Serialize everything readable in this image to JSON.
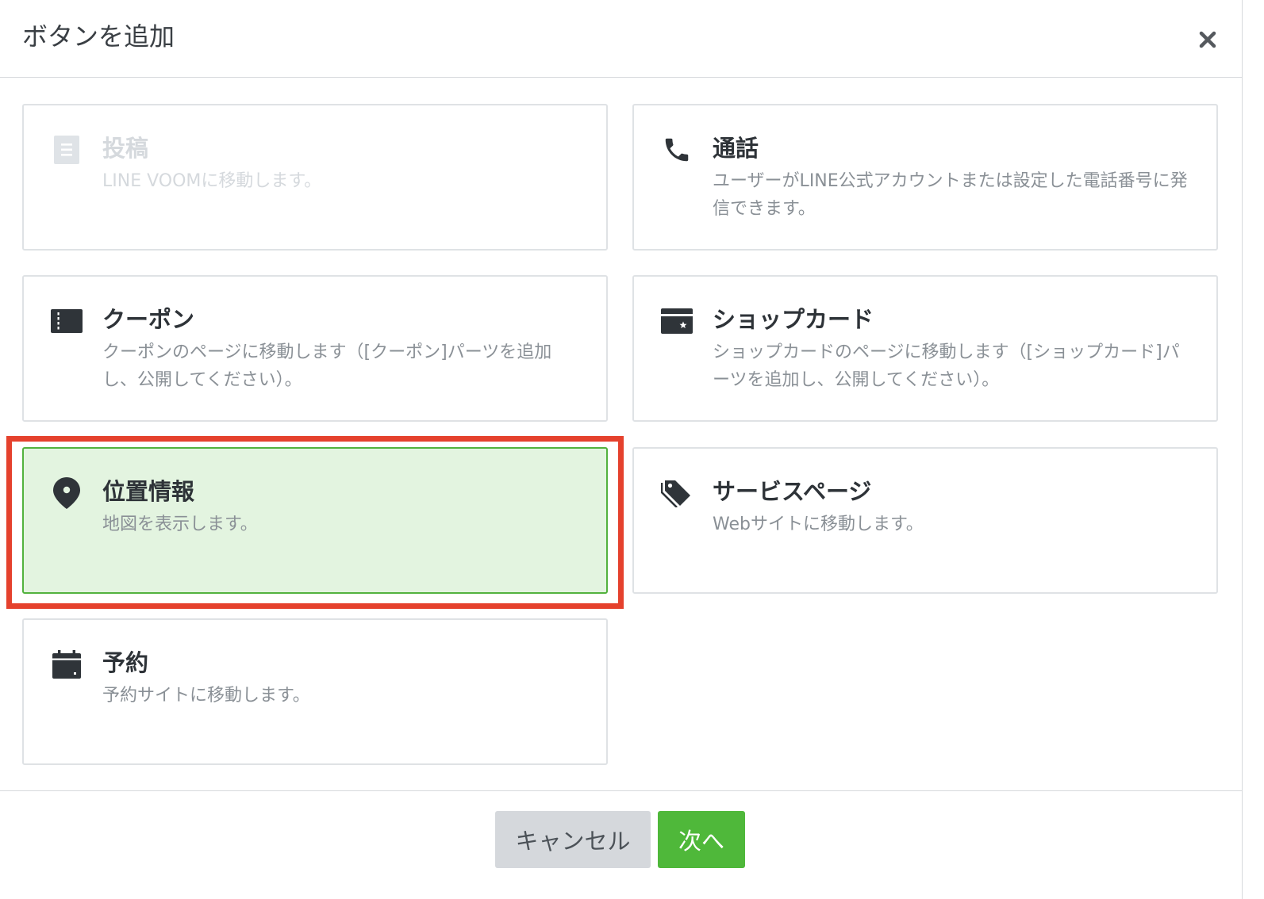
{
  "modal": {
    "title": "ボタンを追加",
    "close_icon": "close-icon"
  },
  "options": [
    {
      "id": "post",
      "icon": "document-icon",
      "title": "投稿",
      "description": "LINE VOOMに移動します。",
      "state": "disabled"
    },
    {
      "id": "call",
      "icon": "phone-icon",
      "title": "通話",
      "description": "ユーザーがLINE公式アカウントまたは設定した電話番号に発信できます。",
      "state": "default"
    },
    {
      "id": "coupon",
      "icon": "coupon-ticket-icon",
      "title": "クーポン",
      "description": "クーポンのページに移動します（[クーポン]パーツを追加し、公開してください）。",
      "state": "default"
    },
    {
      "id": "shopcard",
      "icon": "shop-card-icon",
      "title": "ショップカード",
      "description": "ショップカードのページに移動します（[ショップカード]パーツを追加し、公開してください）。",
      "state": "default"
    },
    {
      "id": "location",
      "icon": "map-pin-icon",
      "title": "位置情報",
      "description": "地図を表示します。",
      "state": "selected"
    },
    {
      "id": "service",
      "icon": "tags-icon",
      "title": "サービスページ",
      "description": "Webサイトに移動します。",
      "state": "default"
    },
    {
      "id": "reservation",
      "icon": "calendar-icon",
      "title": "予約",
      "description": "予約サイトに移動します。",
      "state": "default"
    }
  ],
  "footer": {
    "cancel_label": "キャンセル",
    "next_label": "次へ"
  },
  "colors": {
    "selected_background": "#e3f4e0",
    "selected_border": "#52b23e",
    "primary_button": "#4fb83a",
    "secondary_button": "#d5d8dc",
    "annotation_frame": "#e5412d"
  }
}
